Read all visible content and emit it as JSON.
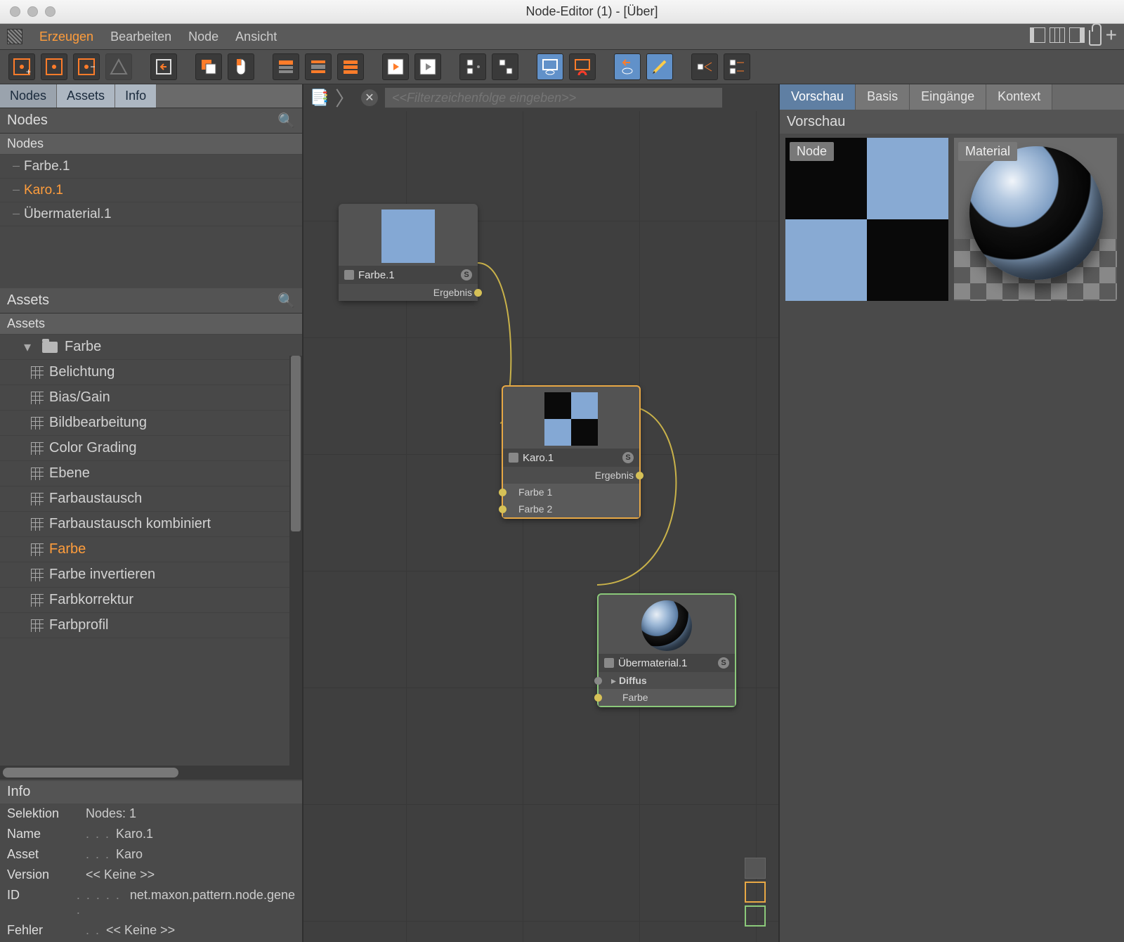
{
  "window": {
    "title": "Node-Editor (1) - [Über]"
  },
  "menu": {
    "items": [
      "Erzeugen",
      "Bearbeiten",
      "Node",
      "Ansicht"
    ],
    "active_index": 0
  },
  "left_tabs": {
    "nodes": "Nodes",
    "assets": "Assets",
    "info": "Info"
  },
  "nodes_section": {
    "header": "Nodes",
    "subheader": "Nodes",
    "items": [
      "Farbe.1",
      "Karo.1",
      "Übermaterial.1"
    ],
    "selected_index": 1
  },
  "assets_section": {
    "header": "Assets",
    "subheader": "Assets",
    "folder": "Farbe",
    "items": [
      "Belichtung",
      "Bias/Gain",
      "Bildbearbeitung",
      "Color Grading",
      "Ebene",
      "Farbaustausch",
      "Farbaustausch kombiniert",
      "Farbe",
      "Farbe invertieren",
      "Farbkorrektur",
      "Farbprofil"
    ],
    "selected_index": 7
  },
  "info_section": {
    "header": "Info",
    "rows": [
      {
        "k": "Selektion",
        "v": "Nodes: 1"
      },
      {
        "k": "Name",
        "v": "Karo.1"
      },
      {
        "k": "Asset",
        "v": "Karo"
      },
      {
        "k": "Version",
        "v": "<< Keine >>"
      },
      {
        "k": "ID",
        "v": "net.maxon.pattern.node.gene"
      },
      {
        "k": "Fehler",
        "v": "<< Keine >>"
      }
    ]
  },
  "canvas": {
    "filter_placeholder": "<<Filterzeichenfolge eingeben>>",
    "nodes": {
      "farbe": {
        "title": "Farbe.1",
        "out": "Ergebnis"
      },
      "karo": {
        "title": "Karo.1",
        "out": "Ergebnis",
        "in1": "Farbe 1",
        "in2": "Farbe 2"
      },
      "uber": {
        "title": "Übermaterial.1",
        "group": "Diffus",
        "in": "Farbe"
      }
    }
  },
  "right": {
    "tabs": [
      "Vorschau",
      "Basis",
      "Eingänge",
      "Kontext"
    ],
    "active_index": 0,
    "header": "Vorschau",
    "preview_labels": {
      "node": "Node",
      "material": "Material"
    }
  }
}
